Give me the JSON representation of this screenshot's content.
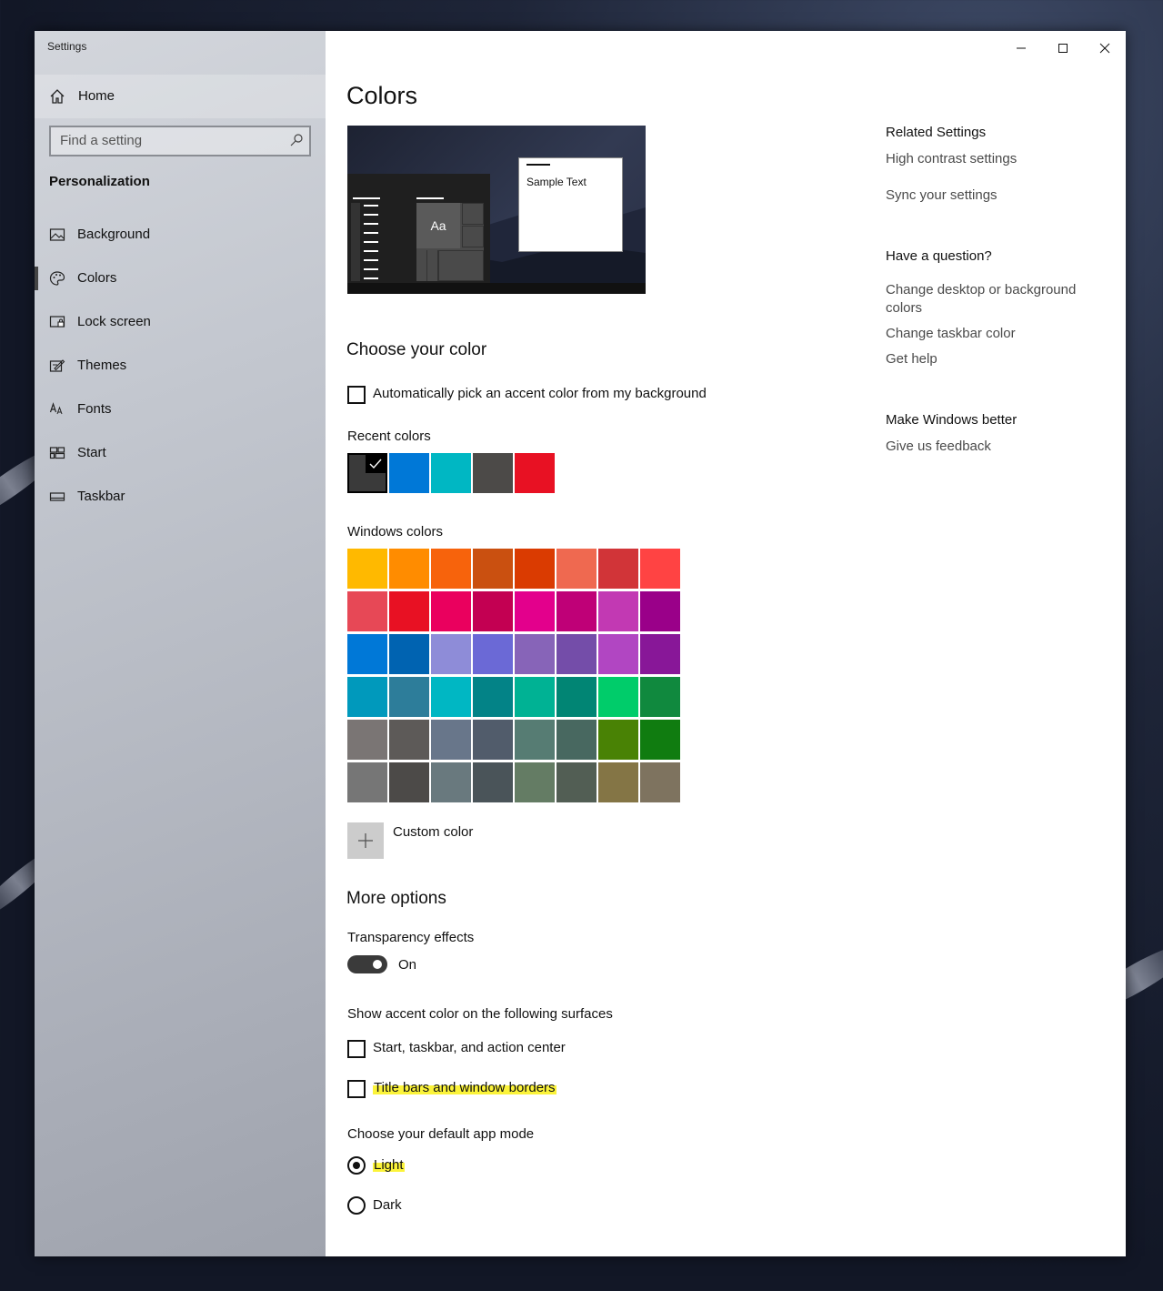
{
  "window": {
    "title": "Settings"
  },
  "sidebar": {
    "home_label": "Home",
    "search_placeholder": "Find a setting",
    "section": "Personalization",
    "items": [
      {
        "label": "Background",
        "icon": "picture-icon"
      },
      {
        "label": "Colors",
        "icon": "palette-icon",
        "selected": true
      },
      {
        "label": "Lock screen",
        "icon": "lock-screen-icon"
      },
      {
        "label": "Themes",
        "icon": "themes-brush-icon"
      },
      {
        "label": "Fonts",
        "icon": "fonts-icon"
      },
      {
        "label": "Start",
        "icon": "start-tiles-icon"
      },
      {
        "label": "Taskbar",
        "icon": "taskbar-icon"
      }
    ]
  },
  "main": {
    "title": "Colors",
    "preview": {
      "sample_text": "Sample Text",
      "tile_text": "Aa"
    },
    "choose_color": {
      "heading": "Choose your color",
      "auto_pick_label": "Automatically pick an accent color from my background",
      "recent_label": "Recent colors",
      "recent_colors": [
        "#3a3a3a",
        "#0078d7",
        "#00b7c3",
        "#4c4a48",
        "#e81123"
      ],
      "windows_label": "Windows colors",
      "windows_colors": [
        [
          "#ffb900",
          "#ff8c00",
          "#f7630c",
          "#ca5010",
          "#da3b01",
          "#ef6950",
          "#d13438",
          "#ff4343"
        ],
        [
          "#e74856",
          "#e81123",
          "#ea005e",
          "#c30052",
          "#e3008c",
          "#bf0077",
          "#c239b3",
          "#9a0089"
        ],
        [
          "#0078d7",
          "#0063b1",
          "#8e8cd8",
          "#6b69d6",
          "#8764b8",
          "#744da9",
          "#b146c2",
          "#881798"
        ],
        [
          "#0099bc",
          "#2d7d9a",
          "#00b7c3",
          "#038387",
          "#00b294",
          "#018574",
          "#00cc6a",
          "#10893e"
        ],
        [
          "#7a7574",
          "#5d5a58",
          "#68768a",
          "#515c6b",
          "#567c73",
          "#486860",
          "#498205",
          "#107c10"
        ],
        [
          "#767676",
          "#4c4a48",
          "#69797e",
          "#4a5459",
          "#647c64",
          "#525e54",
          "#847545",
          "#7e735f"
        ]
      ],
      "custom_label": "Custom color"
    },
    "more_options": {
      "heading": "More options",
      "transparency_label": "Transparency effects",
      "transparency_state": "On",
      "surfaces_label": "Show accent color on the following surfaces",
      "surface_start": "Start, taskbar, and action center",
      "surface_title": "Title bars and window borders",
      "app_mode_label": "Choose your default app mode",
      "mode_light": "Light",
      "mode_dark": "Dark"
    }
  },
  "related": {
    "heading": "Related Settings",
    "links": [
      "High contrast settings",
      "Sync your settings"
    ],
    "question_heading": "Have a question?",
    "question_links": [
      "Change desktop or background colors",
      "Change taskbar color",
      "Get help"
    ],
    "better_heading": "Make Windows better",
    "better_link": "Give us feedback"
  }
}
